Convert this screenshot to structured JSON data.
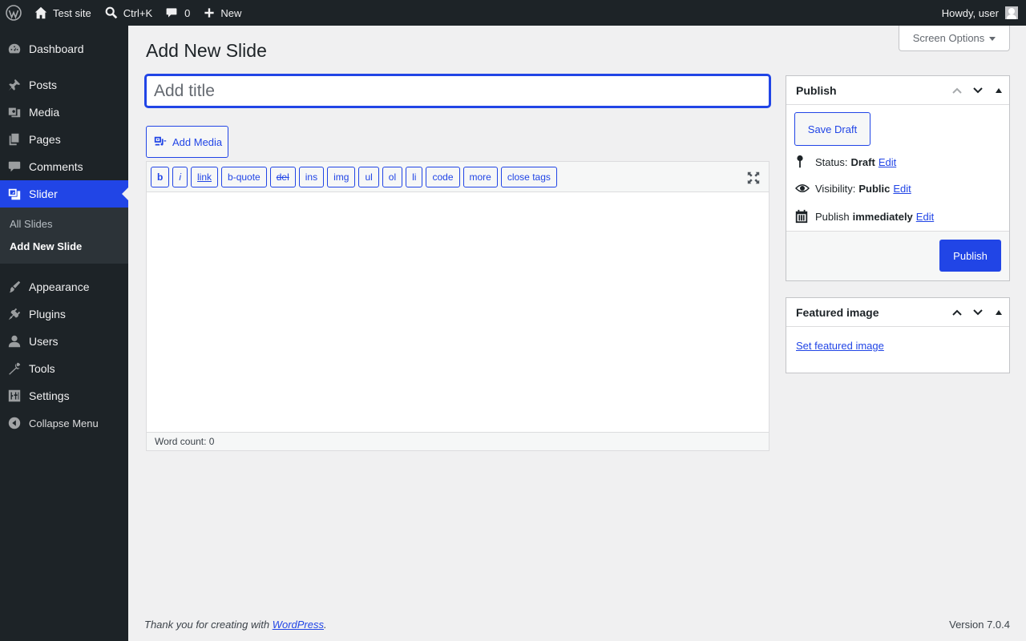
{
  "adminbar": {
    "site_name": "Test site",
    "search_shortcut": "Ctrl+K",
    "comments_count": "0",
    "new_label": "New",
    "greeting": "Howdy, user"
  },
  "sidebar": {
    "items": [
      {
        "label": "Dashboard",
        "icon": "dashboard-icon"
      },
      {
        "label": "Posts",
        "icon": "pushpin-icon"
      },
      {
        "label": "Media",
        "icon": "media-icon"
      },
      {
        "label": "Pages",
        "icon": "pages-icon"
      },
      {
        "label": "Comments",
        "icon": "comment-icon"
      },
      {
        "label": "Slider",
        "icon": "slides-icon"
      },
      {
        "label": "Appearance",
        "icon": "paintbrush-icon"
      },
      {
        "label": "Plugins",
        "icon": "plugin-icon"
      },
      {
        "label": "Users",
        "icon": "user-icon"
      },
      {
        "label": "Tools",
        "icon": "wrench-icon"
      },
      {
        "label": "Settings",
        "icon": "settings-icon"
      }
    ],
    "submenu": [
      "All Slides",
      "Add New Slide"
    ],
    "collapse_label": "Collapse Menu"
  },
  "main": {
    "page_title": "Add New Slide",
    "screen_options": "Screen Options",
    "title_placeholder": "Add title",
    "add_media": "Add Media",
    "quicktags": [
      "b",
      "i",
      "link",
      "b-quote",
      "del",
      "ins",
      "img",
      "ul",
      "ol",
      "li",
      "code",
      "more",
      "close tags"
    ],
    "word_count": "Word count: 0"
  },
  "publish": {
    "heading": "Publish",
    "save_draft": "Save Draft",
    "status_label": "Status:",
    "status_value": "Draft",
    "visibility_label": "Visibility:",
    "visibility_value": "Public",
    "publish_label": "Publish",
    "publish_value": "immediately",
    "edit_label": "Edit",
    "publish_button": "Publish"
  },
  "featured": {
    "heading": "Featured image",
    "link": "Set featured image"
  },
  "footer": {
    "thanks_prefix": "Thank you for creating with",
    "wordpress_link": "WordPress",
    "thanks_suffix": ".",
    "version": "Version 7.0.4"
  },
  "colors": {
    "accent": "#2145e6",
    "adminbar_bg": "#1d2327",
    "page_bg": "#f0f0f1"
  }
}
